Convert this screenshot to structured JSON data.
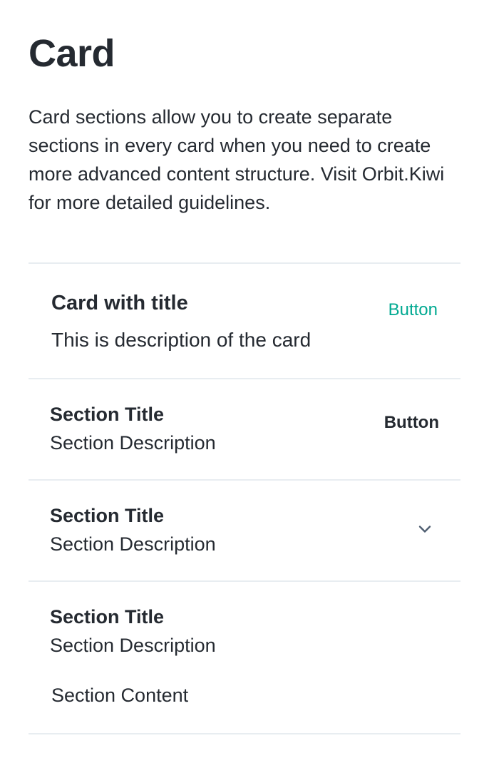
{
  "page": {
    "title": "Card",
    "description": "Card sections allow you to create separate sections in every card when you need to create more advanced content structure. Visit Orbit.Kiwi for more detailed guidelines."
  },
  "card": {
    "header": {
      "title": "Card with title",
      "description": "This is description of the card",
      "action_label": "Button"
    },
    "sections": [
      {
        "title": "Section Title",
        "description": "Section Description",
        "action_label": "Button"
      },
      {
        "title": "Section Title",
        "description": "Section Description",
        "icon": "chevron-down-icon"
      },
      {
        "title": "Section Title",
        "description": "Section Description",
        "content": "Section Content"
      }
    ]
  },
  "colors": {
    "text_primary": "#252a31",
    "accent": "#00a991",
    "divider": "#e8edf1",
    "icon": "#4f5e71"
  }
}
